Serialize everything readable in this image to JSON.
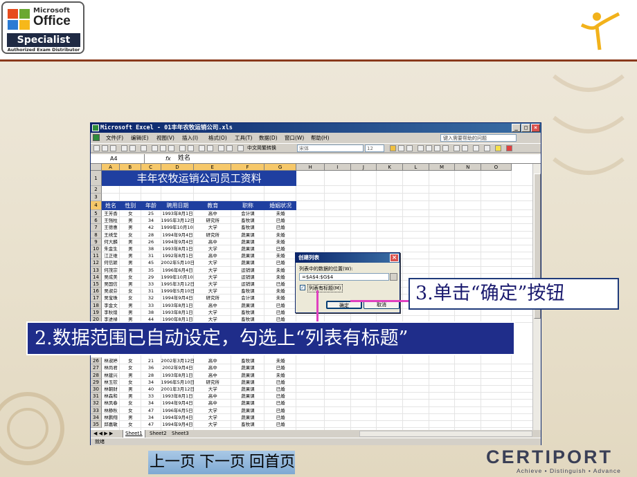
{
  "branding": {
    "mos_top": "Microsoft",
    "mos_office": "Office",
    "mos_specialist": "Specialist",
    "mos_authorized": "Authorized Exam Distributor",
    "certiport_word": "CERTIPORT",
    "certiport_tagline": "Achieve • Distinguish • Advance"
  },
  "window": {
    "title": "Microsoft Excel - 01丰年农牧运销公司.xls",
    "min": "_",
    "max": "□",
    "close": "×"
  },
  "menu": {
    "items": [
      "文件(F)",
      "编辑(E)",
      "视图(V)",
      "插入(I)",
      "格式(O)",
      "工具(T)",
      "数据(D)",
      "窗口(W)",
      "帮助(H)"
    ],
    "help_placeholder": "键入需要帮助的问题"
  },
  "toolbar": {
    "convert": "中文简繁转换",
    "font_name": "宋体",
    "font_size": "12"
  },
  "formula_bar": {
    "name_box": "A4",
    "fx": "fx",
    "value": "姓名"
  },
  "sheet": {
    "columns": [
      "A",
      "B",
      "C",
      "D",
      "E",
      "F",
      "G",
      "H",
      "I",
      "J",
      "K",
      "L",
      "M",
      "N",
      "O"
    ],
    "title": "丰年农牧运销公司员工资料",
    "headers": [
      "姓名",
      "性别",
      "年龄",
      "聘用日期",
      "教育",
      "职称",
      "婚姻状况"
    ],
    "row_numbers": [
      "1",
      "2",
      "3",
      "4",
      "5",
      "6",
      "7",
      "8",
      "9",
      "10",
      "11",
      "12",
      "13",
      "14",
      "15",
      "16",
      "17",
      "18",
      "19",
      "20",
      "26",
      "27",
      "28",
      "29",
      "30",
      "31",
      "32",
      "33",
      "34",
      "35"
    ],
    "rows": [
      {
        "r": "5",
        "d": [
          "王芳香",
          "女",
          "25",
          "1993年8月1日",
          "高中",
          "会计课",
          "未婚"
        ]
      },
      {
        "r": "6",
        "d": [
          "王强柱",
          "男",
          "34",
          "1995年3月12日",
          "研究所",
          "畜牧课",
          "已婚"
        ]
      },
      {
        "r": "7",
        "d": [
          "王德惠",
          "男",
          "42",
          "1999年10月10日",
          "大学",
          "畜牧课",
          "已婚"
        ]
      },
      {
        "r": "8",
        "d": [
          "王绣莹",
          "女",
          "28",
          "1994年9月4日",
          "研究所",
          "蔬果课",
          "未婚"
        ]
      },
      {
        "r": "9",
        "d": [
          "何大麟",
          "男",
          "26",
          "1994年9月4日",
          "高中",
          "蔬果课",
          "未婚"
        ]
      },
      {
        "r": "10",
        "d": [
          "朱金生",
          "男",
          "38",
          "1993年8月1日",
          "大学",
          "蔬果课",
          "已婚"
        ]
      },
      {
        "r": "11",
        "d": [
          "江正维",
          "男",
          "31",
          "1992年8月1日",
          "高中",
          "蔬果课",
          "未婚"
        ]
      },
      {
        "r": "12",
        "d": [
          "何信颖",
          "男",
          "45",
          "2002年5月10日",
          "大学",
          "蔬果课",
          "已婚"
        ]
      },
      {
        "r": "13",
        "d": [
          "何茂宗",
          "男",
          "35",
          "1996年6月4日",
          "大学",
          "运销课",
          "未婚"
        ]
      },
      {
        "r": "14",
        "d": [
          "吴成美",
          "女",
          "29",
          "1999年10月10日",
          "大学",
          "运销课",
          "未婚"
        ]
      },
      {
        "r": "15",
        "d": [
          "吴国信",
          "男",
          "33",
          "1995年3月12日",
          "大学",
          "运销课",
          "已婚"
        ]
      },
      {
        "r": "16",
        "d": [
          "吴淑芬",
          "女",
          "31",
          "1999年5月10日",
          "大学",
          "畜牧课",
          "未婚"
        ]
      },
      {
        "r": "17",
        "d": [
          "吴宝珠",
          "女",
          "32",
          "1994年9月4日",
          "研究所",
          "会计课",
          "未婚"
        ]
      },
      {
        "r": "18",
        "d": [
          "李金文",
          "男",
          "33",
          "1993年8月1日",
          "高中",
          "蔬果课",
          "已婚"
        ]
      },
      {
        "r": "19",
        "d": [
          "李秋煌",
          "男",
          "38",
          "1993年8月1日",
          "大学",
          "畜牧课",
          "已婚"
        ]
      },
      {
        "r": "20",
        "d": [
          "李进禄",
          "男",
          "44",
          "1990年8月1日",
          "大学",
          "畜牧课",
          "已婚"
        ]
      },
      {
        "r": "26",
        "d": [
          "林淑婷",
          "女",
          "21",
          "2002年3月12日",
          "高中",
          "畜牧课",
          "未婚"
        ]
      },
      {
        "r": "27",
        "d": [
          "林尚君",
          "女",
          "36",
          "2002年9月4日",
          "高中",
          "蔬果课",
          "已婚"
        ]
      },
      {
        "r": "28",
        "d": [
          "林建兴",
          "男",
          "28",
          "1993年8月1日",
          "高中",
          "蔬果课",
          "未婚"
        ]
      },
      {
        "r": "29",
        "d": [
          "林玉钦",
          "女",
          "34",
          "1996年5月10日",
          "研究所",
          "蔬果课",
          "已婚"
        ]
      },
      {
        "r": "30",
        "d": [
          "林朝财",
          "男",
          "40",
          "2001年3月12日",
          "大学",
          "蔬果课",
          "已婚"
        ]
      },
      {
        "r": "31",
        "d": [
          "林森和",
          "男",
          "33",
          "1993年8月1日",
          "高中",
          "蔬果课",
          "已婚"
        ]
      },
      {
        "r": "32",
        "d": [
          "林凤春",
          "女",
          "34",
          "1994年9月4日",
          "高中",
          "蔬果课",
          "已婚"
        ]
      },
      {
        "r": "33",
        "d": [
          "林静秋",
          "女",
          "47",
          "1996年6月5日",
          "大学",
          "蔬果课",
          "已婚"
        ]
      },
      {
        "r": "34",
        "d": [
          "林鹏翔",
          "男",
          "34",
          "1994年9月4日",
          "大学",
          "蔬果课",
          "已婚"
        ]
      },
      {
        "r": "35",
        "d": [
          "邱嘉敏",
          "女",
          "47",
          "1994年9月4日",
          "大学",
          "畜牧课",
          "已婚"
        ]
      }
    ],
    "tabs": [
      "Sheet1",
      "Sheet2",
      "Sheet3"
    ],
    "status": "就绪"
  },
  "dialog": {
    "title": "创建列表",
    "label": "列表中的数据的位置(W):",
    "range": "=$A$4:$G$4",
    "check_mark": "✓",
    "checkbox_label": "列表有标题(M)",
    "ok": "确定",
    "cancel": "取消"
  },
  "callouts": {
    "step3": "3.单击“确定”按钮",
    "step2": "2.数据范围已自动设定，勾选上“列表有标题”"
  },
  "nav": {
    "prev": "上一页",
    "next": "下一页",
    "home": "回首页"
  },
  "colors": {
    "title_band": "#1f3fa0",
    "header_band": "#1f3fa0",
    "callout_blue": "#1f2d8a",
    "connector_pink": "#e040c0"
  }
}
